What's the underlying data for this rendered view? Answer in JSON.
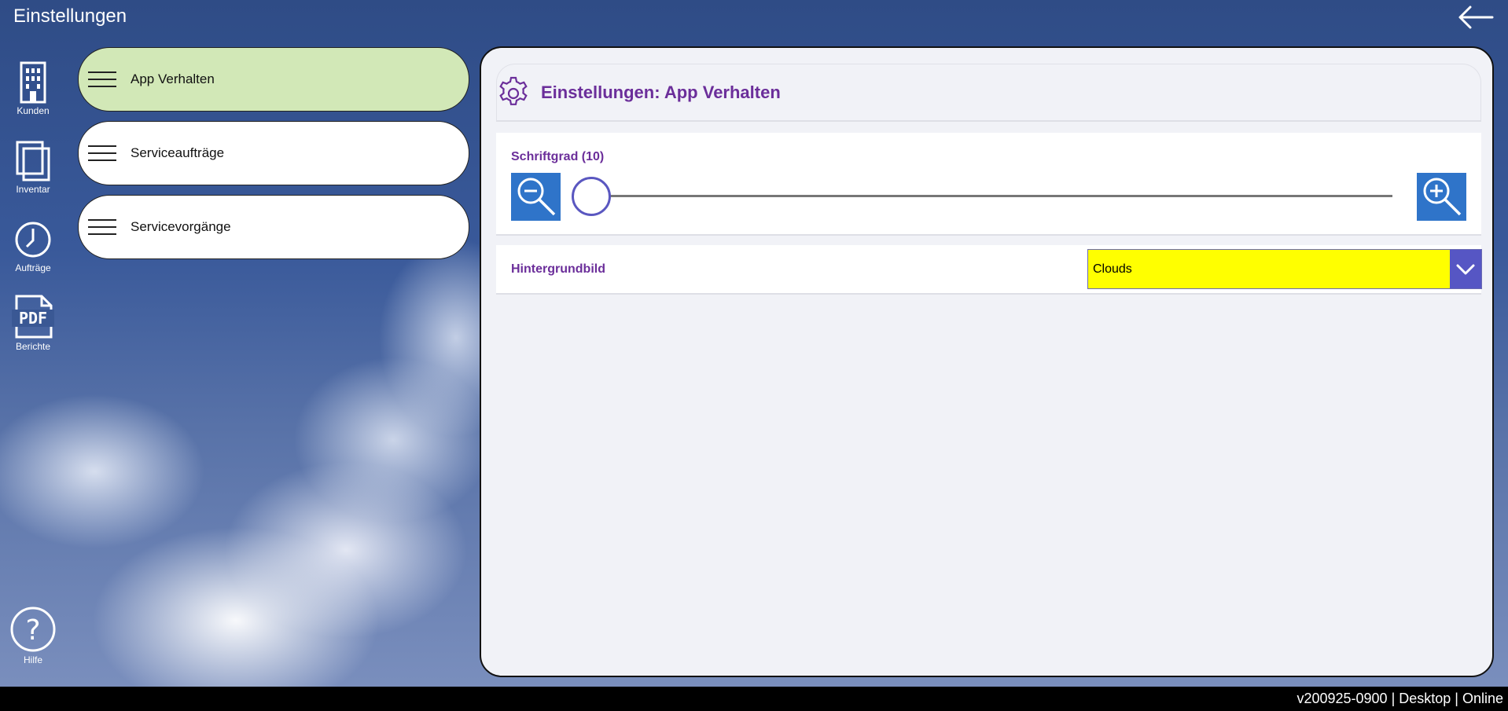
{
  "header": {
    "title": "Einstellungen",
    "back_icon": "arrow-left-icon"
  },
  "rail": {
    "items": [
      {
        "label": "Kunden",
        "icon": "building-icon"
      },
      {
        "label": "Inventar",
        "icon": "documents-icon"
      },
      {
        "label": "Aufträge",
        "icon": "clock-icon"
      },
      {
        "label": "Berichte",
        "icon": "pdf-icon"
      }
    ],
    "help": {
      "label": "Hilfe",
      "icon": "help-icon",
      "glyph": "?"
    }
  },
  "menu": {
    "items": [
      {
        "label": "App Verhalten",
        "active": true
      },
      {
        "label": "Serviceaufträge",
        "active": false
      },
      {
        "label": "Servicevorgänge",
        "active": false
      }
    ]
  },
  "panel": {
    "title": "Einstellungen: App Verhalten",
    "font_size": {
      "label": "Schriftgrad (10)",
      "value": 10,
      "slider_position": 0
    },
    "background": {
      "label": "Hintergrundbild",
      "selected": "Clouds"
    }
  },
  "colors": {
    "accent_purple": "#6b2e9a",
    "zoom_blue": "#2f74c9",
    "active_menu": "#d2e8b7",
    "select_bg": "#ffff00",
    "select_caret": "#5656c4"
  },
  "status": "v200925-0900 | Desktop | Online"
}
